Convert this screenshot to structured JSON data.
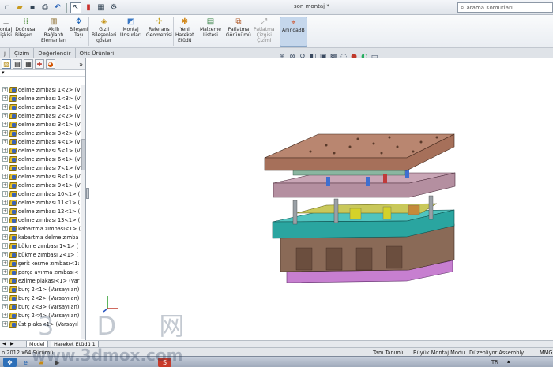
{
  "titlebar": {
    "document_title": "son montaj *",
    "search_placeholder": "arama Komutları",
    "qat_icons": [
      "new-icon",
      "open-icon",
      "save-icon",
      "print-icon",
      "undo-icon",
      "select-icon",
      "rebuild-icon",
      "file-properties-icon",
      "options-icon"
    ]
  },
  "ribbon": {
    "buttons": [
      {
        "name": "montaj-iliskisi",
        "line1": "ontaj",
        "line2": "işkisi",
        "line3": ""
      },
      {
        "name": "dogrusal-bilesen",
        "line1": "Doğrusal",
        "line2": "Bileşen...",
        "line3": ""
      },
      {
        "name": "akilli-baglanti",
        "line1": "Akıllı",
        "line2": "Bağlantı",
        "line3": "Elemanları"
      },
      {
        "name": "bileseni-tasi",
        "line1": "Bileşeni",
        "line2": "Taşı",
        "line3": ""
      },
      {
        "name": "gizli-bilesenleri-goster",
        "line1": "Gizli",
        "line2": "Bileşenleri",
        "line3": "göster"
      },
      {
        "name": "montaj-unsurlari",
        "line1": "Montaj",
        "line2": "Unsurları",
        "line3": ""
      },
      {
        "name": "referans-geometrisi",
        "line1": "Referans",
        "line2": "Geometrisi",
        "line3": ""
      },
      {
        "name": "yeni-hareket-etudu",
        "line1": "Yeni",
        "line2": "Hareket",
        "line3": "Etüdü"
      },
      {
        "name": "malzeme-listesi",
        "line1": "Malzeme",
        "line2": "Listesi",
        "line3": ""
      },
      {
        "name": "patlatma-gorunumu",
        "line1": "Patlatma",
        "line2": "Görünümü",
        "line3": ""
      },
      {
        "name": "patlatma-cizgisi-cizimi",
        "line1": "Patlatma",
        "line2": "Çizgisi",
        "line3": "Çizimi"
      },
      {
        "name": "aninda-3b",
        "line1": "Anında3B",
        "line2": "",
        "line3": ""
      }
    ]
  },
  "tabs": [
    "j",
    "Çizim",
    "Değerlendir",
    "Ofis Ürünleri"
  ],
  "tree": {
    "items": [
      "delme zımbası 1<2> (V",
      "delme zımbası 1<3> (V",
      "delme zımbası 2<1> (V",
      "delme zımbası 2<2> (V",
      "delme zımbası 3<1> (V",
      "delme zımbası 3<2> (V",
      "delme zımbası 4<1> (V",
      "delme zımbası 5<1> (V",
      "delme zımbası 6<1> (V",
      "delme zımbası 7<1> (V",
      "delme zımbası 8<1> (V",
      "delme zımbası 9<1> (V",
      "delme zımbası 10<1> (",
      "delme zımbası 11<1> (",
      "delme zımbası 12<1> (",
      "delme zımbası 13<1> (",
      "kabartma zımbası<1> (",
      "kabartma delme zımba",
      "bükme zımbası 1<1> (",
      "bükme zımbası 2<1> (",
      "şerit kesme zımbası<1:",
      "parça ayırma zımbası<",
      "ezilme plakası<1> (Var",
      "burç 2<1> (Varsayılan)",
      "burç 2<2> (Varsayılan)",
      "burç 2<3> (Varsayılan)",
      "burç 2<4> (Varsayılan)",
      "üst plaka<1> (Varsayıl"
    ]
  },
  "bottom_tabs": {
    "model": "Model",
    "motion": "Hareket Etüdü 1"
  },
  "status": {
    "version": "n 2012 x64 Sürümü",
    "definition": "Tam Tanımlı",
    "mode": "Büyük Montaj Modu",
    "editing": "Düzenliyor Assembly",
    "units": "MMG"
  },
  "taskbar": {
    "language": "TR",
    "watermark_site": "www.3dmox.com",
    "watermark_chars": "3 D 网"
  },
  "colors": {
    "top_plate": "#a6705a",
    "punch_plate": "#b48fa0",
    "die_plate": "#2aa5a0",
    "base_plate": "#8a6a57",
    "bottom_plate": "#c77fd0",
    "punch_holder": "#7aa58e"
  }
}
